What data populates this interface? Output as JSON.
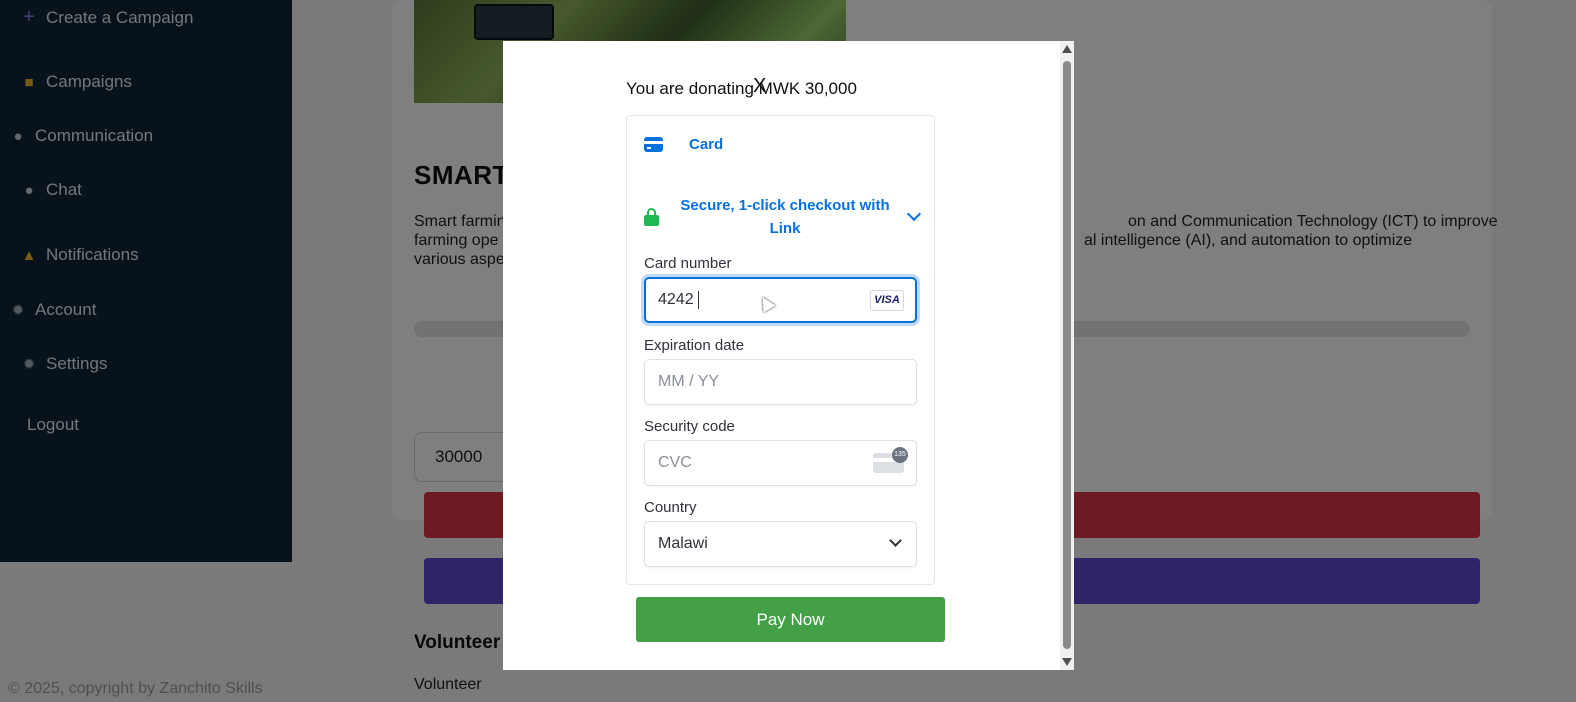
{
  "sidebar": {
    "items": [
      {
        "icon": "plus-icon",
        "label": "Create a Campaign"
      },
      {
        "icon": "folder-icon",
        "label": "Campaigns"
      },
      {
        "icon": "speech-bubble-icon",
        "label": "Communication"
      },
      {
        "icon": "speech-bubble-icon",
        "label": "Chat"
      },
      {
        "icon": "bell-icon",
        "label": "Notifications"
      },
      {
        "icon": "gear-icon",
        "label": "Account"
      },
      {
        "icon": "gear-icon",
        "label": "Settings"
      },
      {
        "icon": "",
        "label": "Logout"
      }
    ]
  },
  "campaign": {
    "title": "SMART",
    "desc_left": "Smart farmin\nfarming ope\nvarious aspe",
    "desc_right_1": "on and Communication Technology (ICT) to improve",
    "desc_right_2": "al intelligence (AI), and automation to optimize",
    "goal_fragment": "al",
    "amount_value": "30000",
    "volunteer_heading": "Volunteer",
    "volunteer_text": "Volunteer"
  },
  "footer": {
    "copyright": "© 2025, copyright by Zanchito Skills"
  },
  "modal": {
    "donate_text": "You are donating MWK 30,000",
    "close_label": "X",
    "card_tab_label": "Card",
    "link_text": "Secure, 1-click checkout with Link",
    "card_number_label": "Card number",
    "card_number_value": "4242",
    "card_brand": "VISA",
    "expiration_label": "Expiration date",
    "expiration_placeholder": "MM / YY",
    "security_label": "Security code",
    "security_placeholder": "CVC",
    "cvc_badge": "135",
    "country_label": "Country",
    "country_value": "Malawi",
    "pay_button": "Pay Now"
  },
  "colors": {
    "sidebar_bg": "#0f2437",
    "stripe_blue": "#0570de",
    "pay_green": "#43a047",
    "danger_red": "#dc3545",
    "primary_purple": "#5a4bd1",
    "link_green": "#1db954"
  }
}
